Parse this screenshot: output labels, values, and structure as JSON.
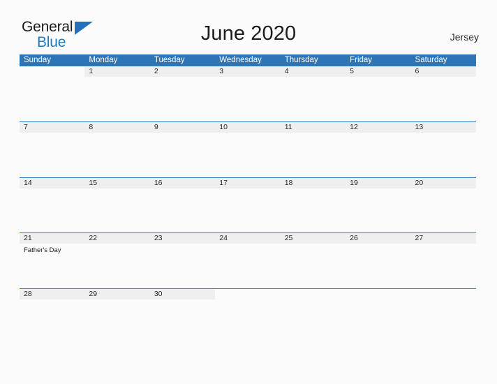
{
  "brand": {
    "line1": "General",
    "line2": "Blue",
    "flag_icon": "blue-triangle-flag-icon",
    "accent_color": "#1f7bc1",
    "flag_color": "#2372b9"
  },
  "header": {
    "title": "June 2020",
    "region": "Jersey"
  },
  "colors": {
    "header_blue": "#2e75b6",
    "day_band_gray": "#efefef",
    "page_background": "#fbfbfb",
    "text": "#242424"
  },
  "calendar": {
    "month": "June",
    "year": "2020",
    "weekday_headers": [
      "Sunday",
      "Monday",
      "Tuesday",
      "Wednesday",
      "Thursday",
      "Friday",
      "Saturday"
    ],
    "weeks": [
      [
        {
          "num": "",
          "events": []
        },
        {
          "num": "1",
          "events": []
        },
        {
          "num": "2",
          "events": []
        },
        {
          "num": "3",
          "events": []
        },
        {
          "num": "4",
          "events": []
        },
        {
          "num": "5",
          "events": []
        },
        {
          "num": "6",
          "events": []
        }
      ],
      [
        {
          "num": "7",
          "events": []
        },
        {
          "num": "8",
          "events": []
        },
        {
          "num": "9",
          "events": []
        },
        {
          "num": "10",
          "events": []
        },
        {
          "num": "11",
          "events": []
        },
        {
          "num": "12",
          "events": []
        },
        {
          "num": "13",
          "events": []
        }
      ],
      [
        {
          "num": "14",
          "events": []
        },
        {
          "num": "15",
          "events": []
        },
        {
          "num": "16",
          "events": []
        },
        {
          "num": "17",
          "events": []
        },
        {
          "num": "18",
          "events": []
        },
        {
          "num": "19",
          "events": []
        },
        {
          "num": "20",
          "events": []
        }
      ],
      [
        {
          "num": "21",
          "events": [
            "Father's Day"
          ]
        },
        {
          "num": "22",
          "events": []
        },
        {
          "num": "23",
          "events": []
        },
        {
          "num": "24",
          "events": []
        },
        {
          "num": "25",
          "events": []
        },
        {
          "num": "26",
          "events": []
        },
        {
          "num": "27",
          "events": []
        }
      ],
      [
        {
          "num": "28",
          "events": []
        },
        {
          "num": "29",
          "events": []
        },
        {
          "num": "30",
          "events": []
        },
        {
          "num": "",
          "events": []
        },
        {
          "num": "",
          "events": []
        },
        {
          "num": "",
          "events": []
        },
        {
          "num": "",
          "events": []
        }
      ]
    ]
  }
}
